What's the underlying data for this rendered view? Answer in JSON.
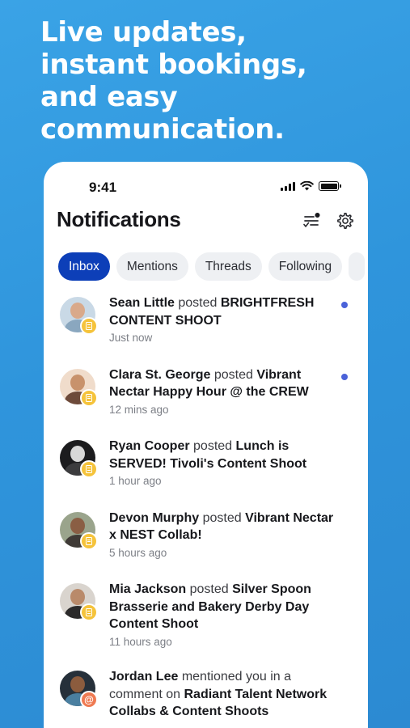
{
  "headline": {
    "line1": "Live updates,",
    "line2": "instant bookings,",
    "line3": "and easy",
    "line4": "communication."
  },
  "status_bar": {
    "time": "9:41"
  },
  "header": {
    "title": "Notifications",
    "icons": [
      "filter-list-icon",
      "gear-icon"
    ]
  },
  "tabs": [
    {
      "label": "Inbox",
      "active": true
    },
    {
      "label": "Mentions",
      "active": false
    },
    {
      "label": "Threads",
      "active": false
    },
    {
      "label": "Following",
      "active": false
    }
  ],
  "notifications": [
    {
      "name": "Sean Little",
      "verb": "posted",
      "subject": "BRIGHTFRESH CONTENT SHOOT",
      "time": "Just now",
      "unread": true,
      "type": "post"
    },
    {
      "name": "Clara St. George",
      "verb": "posted",
      "subject": "Vibrant Nectar Happy Hour @ the CREW",
      "time": "12 mins ago",
      "unread": true,
      "type": "post"
    },
    {
      "name": "Ryan Cooper",
      "verb": "posted",
      "subject": "Lunch is SERVED! Tivoli's Content Shoot",
      "time": "1 hour ago",
      "unread": false,
      "type": "post"
    },
    {
      "name": "Devon Murphy",
      "verb": "posted",
      "subject": "Vibrant Nectar x NEST Collab!",
      "time": "5 hours ago",
      "unread": false,
      "type": "post"
    },
    {
      "name": "Mia Jackson",
      "verb": "posted",
      "subject": "Silver Spoon Brasserie and Bakery Derby Day Content Shoot",
      "time": "11 hours ago",
      "unread": false,
      "type": "post"
    },
    {
      "name": "Jordan Lee",
      "verb": "mentioned you in a comment on",
      "subject": "Radiant Talent Network Collabs & Content Shoots",
      "time": "",
      "unread": false,
      "type": "mention",
      "badge_glyph": "@"
    }
  ],
  "colors": {
    "background": "#2f95dc",
    "active_tab": "#0d3fb8",
    "unread_dot": "#4a62d9",
    "post_badge": "#f5c33b",
    "mention_badge": "#ef7a52"
  }
}
